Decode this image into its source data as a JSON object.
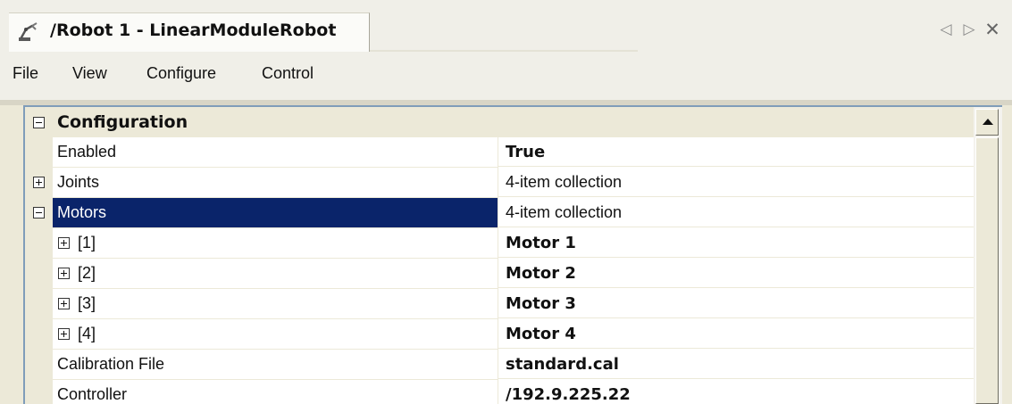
{
  "tab": {
    "title": "/Robot 1 - LinearModuleRobot",
    "icon": "robot-arm-icon"
  },
  "window_controls": {
    "prev_glyph": "◁",
    "next_glyph": "▷",
    "close_glyph": "✕"
  },
  "menu": {
    "items": [
      "File",
      "View",
      "Configure",
      "Control"
    ]
  },
  "grid": {
    "category": "Configuration",
    "rows": [
      {
        "name": "Enabled",
        "value": "True"
      },
      {
        "name": "Joints",
        "value": "4-item collection"
      },
      {
        "name": "Motors",
        "value": "4-item collection"
      },
      {
        "name": "[1]",
        "value": "Motor 1"
      },
      {
        "name": "[2]",
        "value": "Motor 2"
      },
      {
        "name": "[3]",
        "value": "Motor 3"
      },
      {
        "name": "[4]",
        "value": "Motor 4"
      },
      {
        "name": "Calibration File",
        "value": "standard.cal"
      },
      {
        "name": "Controller",
        "value": "/192.9.225.22"
      }
    ]
  },
  "colors": {
    "selection": "#0a246a",
    "gutter": "#ece9d8",
    "border": "#7f9db9"
  }
}
